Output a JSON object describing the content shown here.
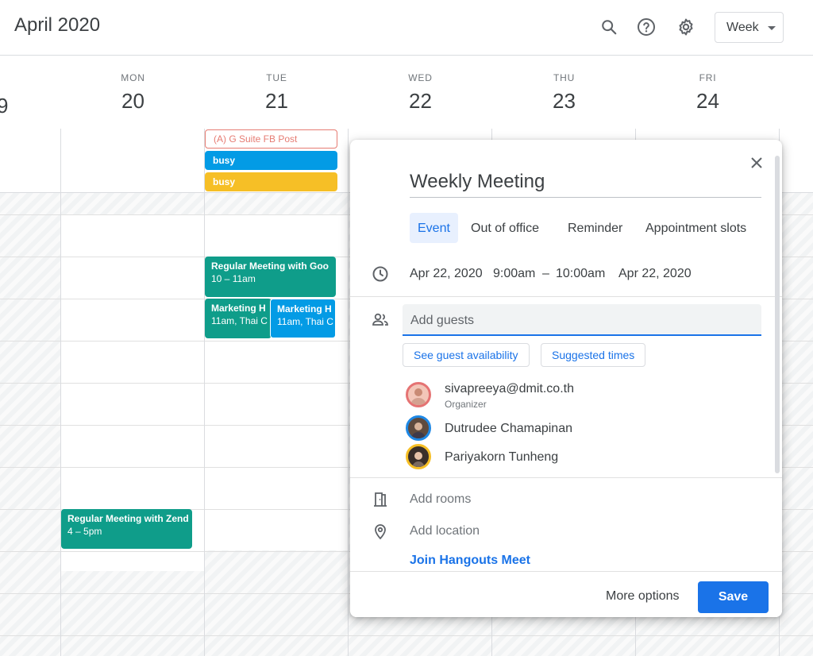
{
  "header": {
    "title": "April 2020",
    "view": "Week",
    "icons": [
      "search-icon",
      "help-icon",
      "gear-icon"
    ]
  },
  "days": [
    {
      "dow": "MON",
      "num": "20"
    },
    {
      "dow": "TUE",
      "num": "21"
    },
    {
      "dow": "WED",
      "num": "22"
    },
    {
      "dow": "THU",
      "num": "23"
    },
    {
      "dow": "FRI",
      "num": "24"
    }
  ],
  "allday": {
    "post": "(A) G Suite FB Post",
    "busy1": "busy",
    "busy2": "busy"
  },
  "events": {
    "tue_meeting": {
      "title": "Regular Meeting with Goo",
      "time": "10 – 11am"
    },
    "tue_marketing1": {
      "title": "Marketing H",
      "time": "11am, Thai C"
    },
    "tue_marketing2": {
      "title": "Marketing H",
      "time": "11am, Thai C"
    },
    "mon_meeting": {
      "title": "Regular Meeting with Zend",
      "time": "4 – 5pm"
    }
  },
  "colors": {
    "teal": "#039be5",
    "green": "#0b8043",
    "event_teal": "#0f9d8a",
    "blue": "#039be5",
    "yellow": "#f6bf26",
    "accent": "#1a73e8"
  },
  "dialog": {
    "title": "Weekly Meeting",
    "tabs": [
      "Event",
      "Out of office",
      "Reminder",
      "Appointment slots"
    ],
    "start_date": "Apr 22, 2020",
    "start_time": "9:00am",
    "dash": "–",
    "end_time": "10:00am",
    "end_date": "Apr 22, 2020",
    "guests_placeholder": "Add guests",
    "see_availability": "See guest availability",
    "suggested_times": "Suggested times",
    "guests": [
      {
        "name": "sivapreeya@dmit.co.th",
        "role": "Organizer",
        "ring": "#e57373"
      },
      {
        "name": "Dutrudee Chamapinan",
        "role": "",
        "ring": "#1e88e5"
      },
      {
        "name": "Pariyakorn Tunheng",
        "role": "",
        "ring": "#f6bf26"
      }
    ],
    "add_rooms": "Add rooms",
    "add_location": "Add location",
    "hangouts": "Join Hangouts Meet",
    "more_options": "More options",
    "save": "Save"
  }
}
